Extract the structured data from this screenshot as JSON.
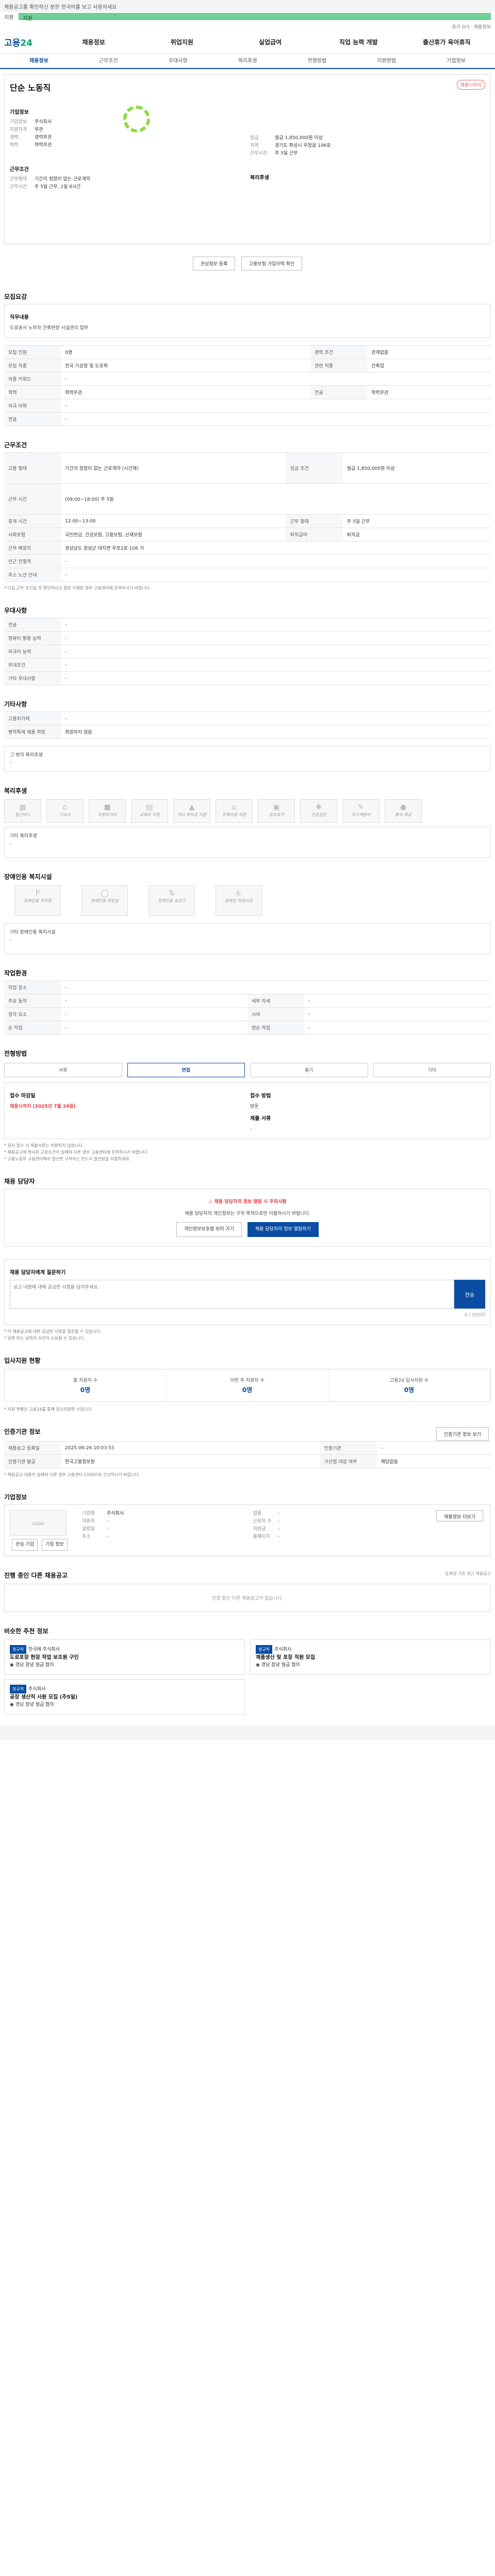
{
  "top": {
    "notice": "채용공고를 확인하신 분은 한국어를 보고 사용하세요",
    "label": "지원",
    "bar": "지원",
    "right": "휴가 0/3 · 채용정보"
  },
  "nav": {
    "logo1": "고용",
    "logo2": "24",
    "menu": [
      "채용정보",
      "취업지원",
      "실업급여",
      "직업 능력 개발",
      "출산휴가 육아휴직"
    ]
  },
  "tabs": [
    "채용정보",
    "근무조건",
    "우대사항",
    "복리후생",
    "전형방법",
    "지원방법",
    "기업정보"
  ],
  "job": {
    "badge": "채용시까지",
    "title": "단순 노동직",
    "company_label": "기업정보",
    "company": "주식회사",
    "rows": [
      [
        "지원자격",
        "무관"
      ],
      [
        "경력",
        "경력무관"
      ],
      [
        "학력",
        "학력무관"
      ]
    ],
    "rows2": [
      [
        "임금",
        "월급 1,850,000원 이상"
      ],
      [
        "지역",
        "경기도 화성시 우정읍 106호"
      ],
      [
        "근무시간",
        "주 5일 근무"
      ]
    ],
    "cond_title": "근무조건",
    "cond_label": "복리후생",
    "cond": [
      [
        "근무형태",
        "기간의 정함이 없는 근로계약"
      ],
      [
        "근무시간",
        "주 5일 근무, 1일 8시간"
      ]
    ],
    "btn1": "관심정보 등록",
    "btn2": "고용보험 가입이력 확인"
  },
  "s1": {
    "title": "모집요강",
    "head": "직무내용",
    "desc": "도로공사 노무자 건축현장 시설관리 업무",
    "rows": [
      [
        "모집 인원",
        "0명",
        "경력 조건",
        "관계없음"
      ],
      [
        "모집 직종",
        "전국 기상청 및 도로화",
        "관련 직종",
        "건축업"
      ],
      [
        "직종 키워드",
        "-",
        "",
        ""
      ],
      [
        "학력",
        "학력무관",
        "전공",
        "학력무관"
      ],
      [
        "외국 어학",
        "-",
        "",
        ""
      ],
      [
        "전공",
        "-",
        "",
        ""
      ]
    ]
  },
  "s2": {
    "title": "근무조건",
    "rows": [
      [
        "고용 형태",
        "기간의 정함이 없는 근로계약 (시간제)",
        "임금 조건",
        "월급 1,850,000원 이상"
      ],
      [
        "근무 시간",
        "(09:00~18:00) 주 5일",
        "",
        ""
      ],
      [
        "휴게 시간",
        "12:00~13:00",
        "근무 형태",
        "주 5일 근무"
      ],
      [
        "사회보험",
        "국민연금, 건강보험, 고용보험, 산재보험",
        "퇴직급여",
        "퇴직금"
      ],
      [
        "근무 예정지",
        "경상남도 창녕군 대지면 우포2로 106 가",
        "",
        ""
      ],
      [
        "인근 전철역",
        "-",
        "",
        ""
      ],
      [
        "주소 노선 안내",
        "-",
        "",
        ""
      ]
    ],
    "note": "* 다음 근무 조건을 꼭 확인하시고 잘못 기재된 경우 고용센터에 문의하시기 바랍니다."
  },
  "s3": {
    "title": "우대사항",
    "rows": [
      [
        "전공",
        "-"
      ],
      [
        "컴퓨터 활용 능력",
        "-"
      ],
      [
        "외국어 능력",
        "-"
      ],
      [
        "우대조건",
        "-"
      ],
      [
        "기타 우대사항",
        "-"
      ]
    ]
  },
  "s4": {
    "title": "기타사항",
    "rows": [
      [
        "고용허가제",
        "-"
      ],
      [
        "병역특례 채용 희망",
        "희망하지 않음"
      ]
    ],
    "extra_title": "그 밖의 복리후생",
    "extra": "-"
  },
  "s5": {
    "title": "복리후생",
    "icons": [
      "통근버스",
      "기숙사",
      "차량유지비",
      "교육비 지원",
      "자녀 학자금 지원",
      "주택자금 지원",
      "경조휴가",
      "건강검진",
      "자기계발비",
      "중식 제공"
    ],
    "etc_title": "기타 복리후생",
    "etc": "-"
  },
  "s6": {
    "title": "장애인용 복지시설",
    "icons": [
      "장애인용 주차장",
      "장애인용 화장실",
      "장애인용 승강기",
      "장애인 작업시설"
    ],
    "etc_title": "기타 장애인용 복지시설",
    "etc": "-"
  },
  "s7": {
    "title": "작업환경",
    "rows": [
      [
        "작업 장소",
        "-",
        "",
        ""
      ],
      [
        "주요 동작",
        "-",
        "세부 자세",
        "-"
      ],
      [
        "청각 요소",
        "-",
        "시야",
        "-"
      ],
      [
        "손 작업",
        "-",
        "양손 작업",
        "-"
      ]
    ]
  },
  "s8": {
    "title": "전형방법",
    "steps": [
      "서류",
      "면접",
      "필기",
      "기타"
    ],
    "info_label": "접수 마감일",
    "info_val": "채용시까지 (2025년 7월 24일)",
    "method_label": "접수 방법",
    "method": "방문",
    "docs_label": "제출 서류",
    "docs": "-",
    "notes": [
      "* 원서 접수 시 제출서류는 반환되지 않습니다.",
      "* 채용공고에 명시된 근로조건이 실제와 다른 경우 고용센터에 문의하시기 바랍니다.",
      "* 고용노동부 고용센터에서 알선한 구직자는 반드시 알선장을 지참하세요."
    ]
  },
  "s9": {
    "title": "채용 담당자",
    "warn": "채용 담당자의 정보 열람 시 주의사항",
    "warn_desc": "채용 담당자의 개인정보는 구직 목적으로만 이용하시기 바랍니다.",
    "btn1": "개인정보보호법 보러 가기",
    "btn2": "채용 담당자의 정보 열람하기"
  },
  "s10": {
    "title": "채용 담당자에게 질문하기",
    "placeholder": "공고 내용에 대해 궁금한 사항을 남겨주세요.",
    "send": "전송",
    "count": "0 / 500자",
    "notes": [
      "* 이 채용공고에 대한 궁금한 사항을 질문할 수 있습니다.",
      "* 답변 받는 날까지 시간이 소요될 수 있습니다."
    ]
  },
  "s11": {
    "title": "입사지원 현황",
    "stats": [
      [
        "총 지원자 수",
        "0명"
      ],
      [
        "이번 주 지원자 수",
        "0명"
      ],
      [
        "고용24 입사지원 수",
        "0명"
      ]
    ],
    "note": "* 지원 현황은 고용24를 통해 입사지원한 수입니다."
  },
  "s12": {
    "title": "인증기관 정보",
    "btn": "인증기관 정보 보기",
    "rows": [
      [
        "채용공고 등록일",
        "2025-06-26 10:03:53",
        "인증기관",
        "-"
      ],
      [
        "인증기관 발급",
        "한국고용정보원",
        "가산점 대상 여부",
        "해당없음"
      ]
    ],
    "note": "* 채용공고 내용이 실제와 다른 경우 고용센터 1350으로 신고하시기 바랍니다."
  },
  "s13": {
    "title": "기업정보",
    "btn": "채용정보 더보기",
    "logo": "LOGO",
    "btns": [
      "관심 기업",
      "기업 정보"
    ],
    "rows": [
      [
        "기업명",
        "주식회사",
        "업종",
        "-"
      ],
      [
        "대표자",
        "-",
        "근로자 수",
        "-"
      ],
      [
        "설립일",
        "-",
        "자본금",
        "-"
      ],
      [
        "주소",
        "-",
        "홈페이지",
        "-"
      ]
    ]
  },
  "s14": {
    "title": "진행 중인 다른 채용공고",
    "empty": "진행 중인 다른 채용공고가 없습니다.",
    "right": "등록일 기준 최근 채용공고"
  },
  "s15": {
    "title": "비슷한 추천 정보",
    "jobs": [
      {
        "tag": "정규직",
        "co": "한국에 주식회사",
        "t": "도로포장 현장 작업 보조원 구인",
        "loc": "경남 창녕",
        "sal": "월급 협의"
      },
      {
        "tag": "정규직",
        "co": "주식회사",
        "t": "제품생산 및 포장 직원 모집",
        "loc": "경남 창녕",
        "sal": "월급 협의"
      },
      {
        "tag": "정규직",
        "co": "주식회사",
        "t": "공장 생산직 사원 모집 (주5일)",
        "loc": "경남 창녕",
        "sal": "월급 협의"
      }
    ]
  }
}
